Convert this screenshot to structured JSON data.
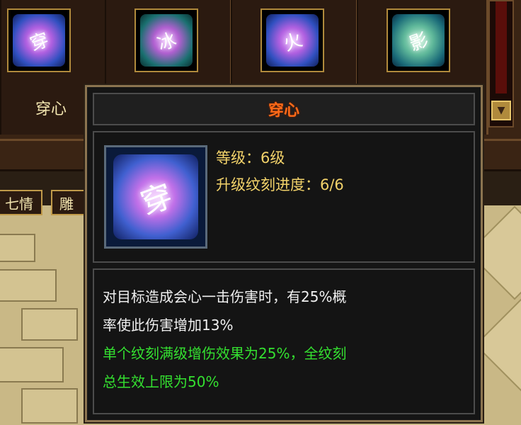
{
  "skill_slots": [
    {
      "label": "穿心",
      "glyph": "穿",
      "style": "purple"
    },
    {
      "label": "",
      "glyph": "冰",
      "style": "purple"
    },
    {
      "label": "",
      "glyph": "火",
      "style": "purple"
    },
    {
      "label": "",
      "glyph": "影",
      "style": "green"
    }
  ],
  "tabs": [
    "七情",
    "雕"
  ],
  "scroll_down_icon": "chevron-down-icon",
  "tooltip": {
    "title": "穿心",
    "icon_glyph": "穿",
    "level_text": "等级：6级",
    "progress_text": "升级纹刻进度：6/6",
    "description_lines": [
      "对目标造成会心一击伤害时，有25%概",
      "率使此伤害增加13%"
    ],
    "bonus_lines": [
      "单个纹刻满级增伤效果为25%，全纹刻",
      "总生效上限为50%"
    ]
  },
  "colors": {
    "title": "#ff6a18",
    "stat": "#f2d26a",
    "description": "#f0f0f0",
    "bonus": "#34e030"
  }
}
